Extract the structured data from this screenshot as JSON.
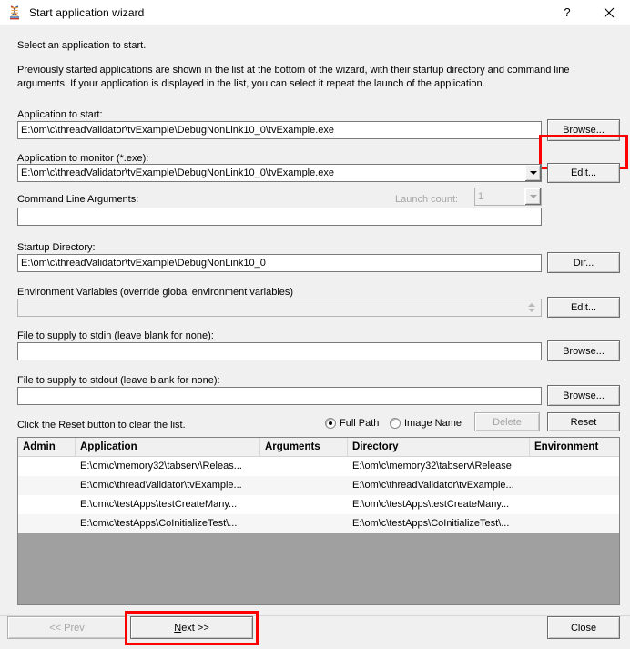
{
  "window": {
    "title": "Start application wizard",
    "icon": "dna-helix-icon",
    "help_label": "?",
    "close_label": "✕"
  },
  "intro": {
    "heading": "Select an application to start.",
    "paragraph": "Previously started applications are shown in the list at the bottom of the wizard, with their startup directory and command line arguments. If your application is displayed in the list, you can select it repeat the launch of the application."
  },
  "fields": {
    "app_to_start": {
      "label": "Application to start:",
      "value": "E:\\om\\c\\threadValidator\\tvExample\\DebugNonLink10_0\\tvExample.exe",
      "button": "Browse..."
    },
    "app_to_monitor": {
      "label": "Application to monitor (*.exe):",
      "value": "E:\\om\\c\\threadValidator\\tvExample\\DebugNonLink10_0\\tvExample.exe",
      "button": "Edit..."
    },
    "command_line": {
      "label": "Command Line Arguments:",
      "value": ""
    },
    "launch_count": {
      "label": "Launch count:",
      "value": "1"
    },
    "startup_dir": {
      "label": "Startup Directory:",
      "value": "E:\\om\\c\\threadValidator\\tvExample\\DebugNonLink10_0",
      "button": "Dir..."
    },
    "env_vars": {
      "label": "Environment Variables (override global environment variables)",
      "value": "",
      "button": "Edit..."
    },
    "stdin": {
      "label": "File to supply to stdin (leave blank for none):",
      "value": "",
      "button": "Browse..."
    },
    "stdout": {
      "label": "File to supply to stdout (leave blank for none):",
      "value": "",
      "button": "Browse..."
    }
  },
  "list_controls": {
    "hint": "Click the Reset button to clear the list.",
    "radio_full_path": "Full Path",
    "radio_image_name": "Image Name",
    "radio_selected": "Full Path",
    "delete_button": "Delete",
    "reset_button": "Reset"
  },
  "table": {
    "columns": [
      "Admin",
      "Application",
      "Arguments",
      "Directory",
      "Environment"
    ],
    "rows": [
      {
        "admin": "",
        "application": "E:\\om\\c\\memory32\\tabserv\\Releas...",
        "arguments": "",
        "directory": "E:\\om\\c\\memory32\\tabserv\\Release",
        "environment": ""
      },
      {
        "admin": "",
        "application": "E:\\om\\c\\threadValidator\\tvExample...",
        "arguments": "",
        "directory": "E:\\om\\c\\threadValidator\\tvExample...",
        "environment": ""
      },
      {
        "admin": "",
        "application": "E:\\om\\c\\testApps\\testCreateMany...",
        "arguments": "",
        "directory": "E:\\om\\c\\testApps\\testCreateMany...",
        "environment": ""
      },
      {
        "admin": "",
        "application": "E:\\om\\c\\testApps\\CoInitializeTest\\...",
        "arguments": "",
        "directory": "E:\\om\\c\\testApps\\CoInitializeTest\\...",
        "environment": ""
      }
    ]
  },
  "footer": {
    "prev_button": "<< Prev",
    "next_button_pre": "",
    "next_button_accel": "N",
    "next_button_post": "ext >>",
    "close_button": "Close"
  },
  "colors": {
    "highlight": "#fe0000",
    "dialog_bg": "#f0f0f0",
    "list_empty_bg": "#a0a0a0"
  }
}
